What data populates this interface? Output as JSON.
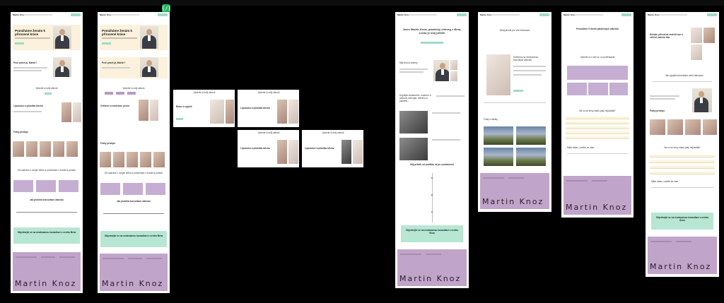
{
  "toolbar": {
    "code_badge": "{/}"
  },
  "brand": "Martin Knoz",
  "colors": {
    "cream": "#fbf1dc",
    "mint": "#b7e6d2",
    "purple": "#c6aed2",
    "footer": "#c1a4c9",
    "accent": "#8a5ca8"
  },
  "frame1": {
    "hero_title": "Pomáháme ženám k přirozené kráse",
    "why_title": "Proč právě já, Martin?",
    "section_title": "Vyberte si svůj zákrok",
    "service_title": "Liposukce a plastika břicha",
    "photos_title": "Fotky před/po",
    "gallery_title": "Od operace k novým kilům a proměnám v moderní prostor",
    "cost_title": "Jak probíhá konzultace zákroku",
    "cta_title": "Objednejte se na nezávaznou konzultaci v centru Brna"
  },
  "frame2": {
    "hero_title": "Pomáháme ženám k přirozené kráse",
    "why_title": "Proč právě já, Martin?",
    "section_title": "Vyberte si svůj zákrok",
    "service_title": "Zvětšení a modelace prsou",
    "photos_title": "Fotky před/po",
    "gallery_title": "Od operace k novým kilům a proměnám v moderní prostor",
    "cost_title": "Jak probíhá konzultace zákroku",
    "cta_title": "Objednejte se na nezávaznou konzultaci v centru Brna"
  },
  "cards": [
    {
      "head": "Vyberte si svůj zákrok",
      "title": "Botox a výplně"
    },
    {
      "head": "Vyberte si svůj zákrok",
      "title": "Liposukce a plastika břicha"
    },
    {
      "head": "Vyberte si svůj zákrok",
      "title": "Liposukce a plastika břicha"
    },
    {
      "head": "Vyberte si svůj zákrok",
      "title": "Liposukce a plastika břicha"
    }
  ],
  "frame7": {
    "hero_title": "Jsem Martin Knoz, plastický chirurg z Brna, a toto je můj příběh",
    "s1": "Můj život a kořeny",
    "s2": "Dopřejte zkušeného, moderní a vstřícné chirurgie, kterého si pacienti...",
    "story": "Můj příběh od počátku až po současnost",
    "cta": "Objednejte se na nezávaznou konzultaci v centru Brna"
  },
  "frame8": {
    "hero_title": "Nezbytnosti pro vše informace",
    "s1": "Doktorka na nezávaznou konzultaci zákroku",
    "photos": "Fotky z kliniky"
  },
  "frame9": {
    "hero_title": "Provádíme 5 druhů plastických zákroků",
    "s1": "Vyberte si z nich to, co potřebujete",
    "faq": "Na co se ženy často ptají nejčastěji?",
    "contact": "Máte dotaz, ozvěte se nám"
  },
  "frame10": {
    "hero_title": "Dokážu přirozeně změnit tvar a vzhled vašeho těla",
    "s1": "Jak vypadá konzultace před zákrokem",
    "photos": "Fotky před/po",
    "faq": "Na co se ženy často ptají nejčastěji?",
    "contact": "Máte dotaz, ozvěte se nám",
    "cta": "Objednejte se na nezávaznou konzultaci v centru Brna"
  }
}
